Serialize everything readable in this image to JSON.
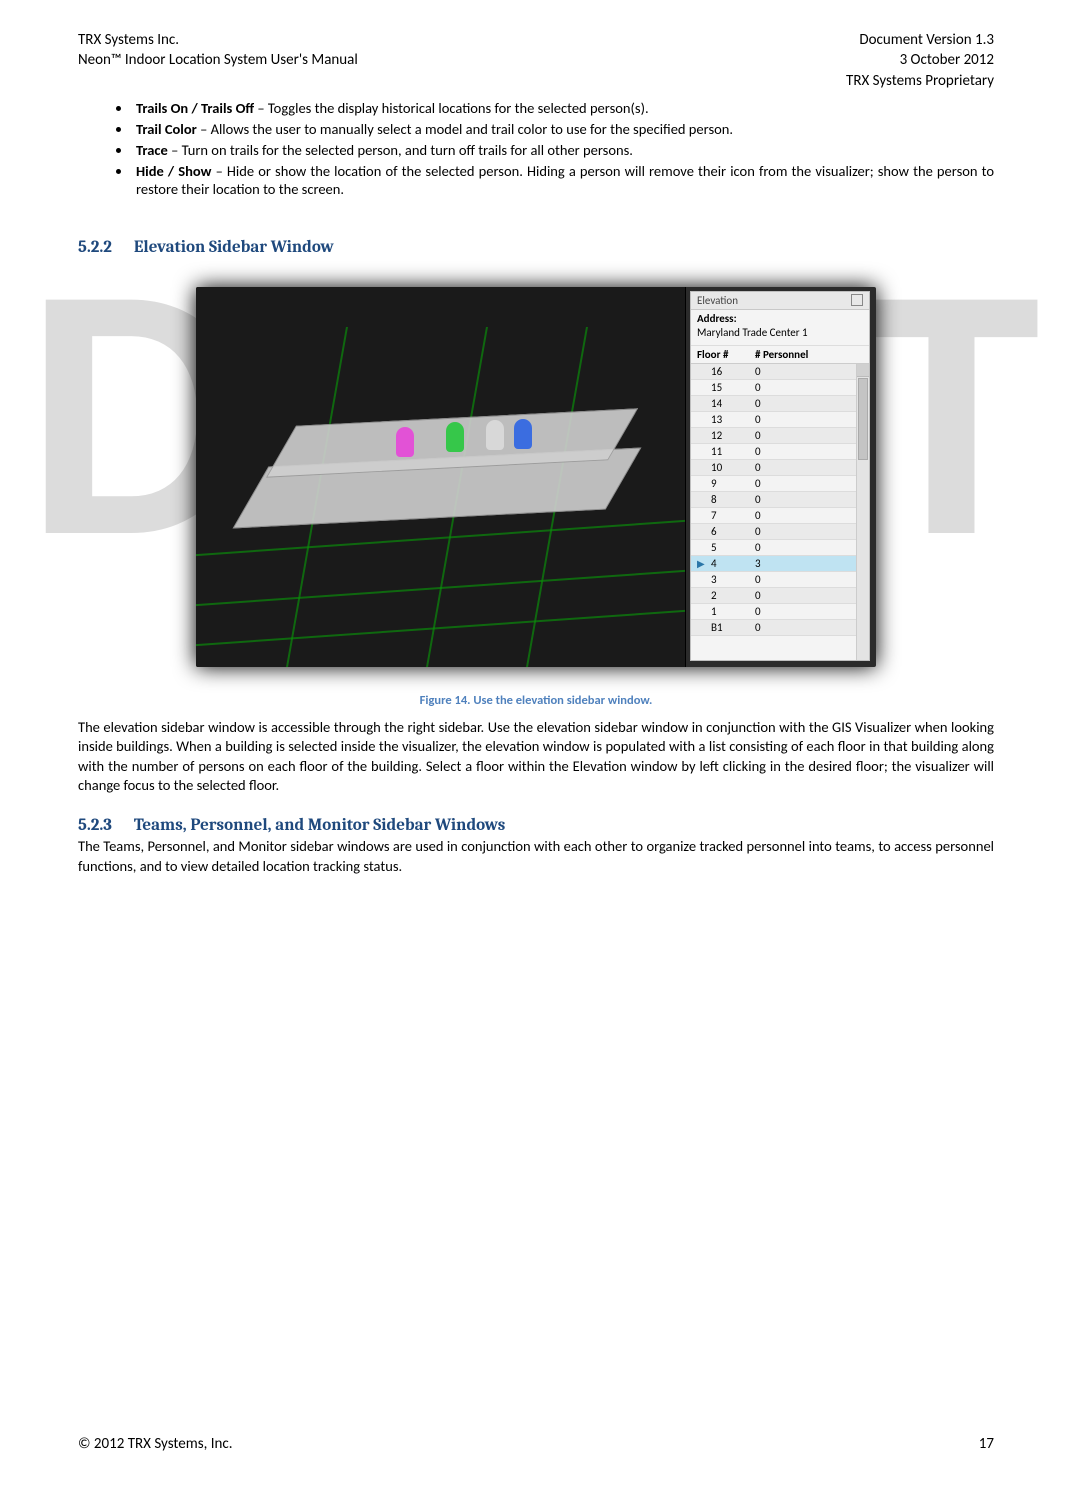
{
  "header": {
    "left1": "TRX Systems Inc.",
    "left2": "Neon™ Indoor Location System User's Manual",
    "right1": "Document Version 1.3",
    "right2": "3 October 2012",
    "right3": "TRX Systems Proprietary"
  },
  "bullets": [
    {
      "term": "Trails On / Trails Off",
      "text": " – Toggles the display historical locations for the selected person(s)."
    },
    {
      "term": "Trail Color",
      "text": " – Allows the user to manually select a model and trail color to use for the specified person."
    },
    {
      "term": "Trace",
      "text": " – Turn on trails for the selected person, and turn off trails for all other persons."
    },
    {
      "term": "Hide / Show",
      "text": " – Hide or show the location of the selected person.  Hiding a person will remove their icon from the visualizer; show the person to restore their location to the screen."
    }
  ],
  "section522": {
    "num": "5.2.2",
    "title": "Elevation Sidebar Window"
  },
  "elevation_panel": {
    "title": "Elevation",
    "address_label": "Address:",
    "address_value": "Maryland Trade Center 1",
    "col1": "Floor #",
    "col2": "# Personnel",
    "rows": [
      {
        "floor": "16",
        "count": "0"
      },
      {
        "floor": "15",
        "count": "0"
      },
      {
        "floor": "14",
        "count": "0"
      },
      {
        "floor": "13",
        "count": "0"
      },
      {
        "floor": "12",
        "count": "0"
      },
      {
        "floor": "11",
        "count": "0"
      },
      {
        "floor": "10",
        "count": "0"
      },
      {
        "floor": "9",
        "count": "0"
      },
      {
        "floor": "8",
        "count": "0"
      },
      {
        "floor": "7",
        "count": "0"
      },
      {
        "floor": "6",
        "count": "0"
      },
      {
        "floor": "5",
        "count": "0"
      },
      {
        "floor": "4",
        "count": "3",
        "selected": true
      },
      {
        "floor": "3",
        "count": "0"
      },
      {
        "floor": "2",
        "count": "0"
      },
      {
        "floor": "1",
        "count": "0"
      },
      {
        "floor": "B1",
        "count": "0"
      }
    ]
  },
  "figure_caption": "Figure 14.  Use the elevation sidebar window.",
  "para522": "The elevation sidebar window is accessible through the right sidebar.  Use the elevation sidebar window in conjunction with the GIS Visualizer when looking inside buildings.  When a building is selected inside the visualizer, the elevation window is populated with a list consisting of each floor in that building along with the number of persons on each floor of the building.  Select a floor within the Elevation window by left clicking in the desired floor; the visualizer will change focus to the selected floor.",
  "section523": {
    "num": "5.2.3",
    "title": "Teams, Personnel, and Monitor Sidebar Windows"
  },
  "para523": "The Teams, Personnel, and Monitor sidebar windows are used in conjunction with each other to organize tracked personnel into teams, to access personnel functions, and to view detailed location tracking status.",
  "watermark": "DRAFT",
  "footer": {
    "left": "© 2012 TRX Systems, Inc.",
    "right": "17"
  }
}
